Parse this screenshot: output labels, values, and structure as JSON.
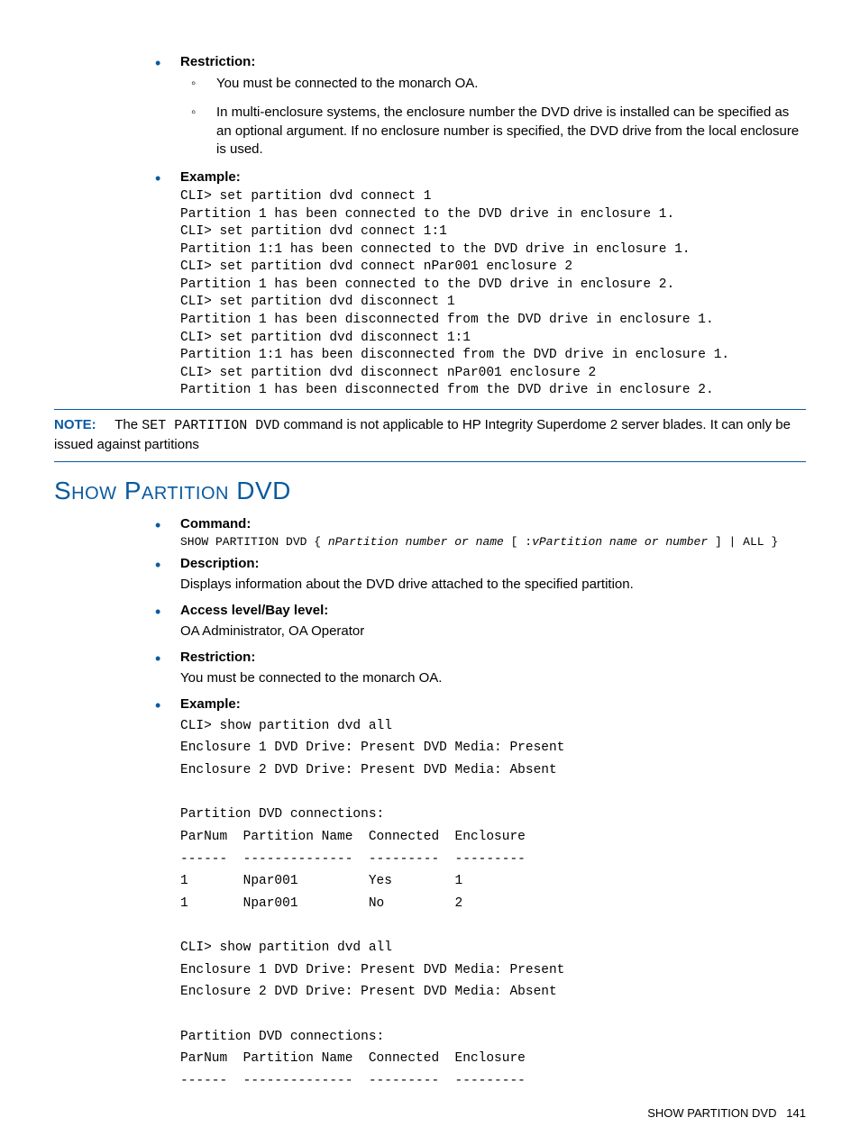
{
  "top": {
    "restriction_label": "Restriction:",
    "restriction_items": [
      "You must be connected to the monarch OA.",
      "In multi-enclosure systems, the enclosure number the DVD drive is installed can be specified as an optional argument. If no enclosure number is specified, the DVD drive from the local enclosure is used."
    ],
    "example_label": "Example:",
    "example_code": "CLI> set partition dvd connect 1\nPartition 1 has been connected to the DVD drive in enclosure 1.\nCLI> set partition dvd connect 1:1\nPartition 1:1 has been connected to the DVD drive in enclosure 1.\nCLI> set partition dvd connect nPar001 enclosure 2\nPartition 1 has been connected to the DVD drive in enclosure 2.\nCLI> set partition dvd disconnect 1\nPartition 1 has been disconnected from the DVD drive in enclosure 1.\nCLI> set partition dvd disconnect 1:1\nPartition 1:1 has been disconnected from the DVD drive in enclosure 1.\nCLI> set partition dvd disconnect nPar001 enclosure 2\nPartition 1 has been disconnected from the DVD drive in enclosure 2."
  },
  "note": {
    "label": "NOTE:",
    "pre": "The ",
    "code": "SET PARTITION DVD",
    "post": " command is not applicable to HP Integrity Superdome 2 server blades. It can only be issued against partitions"
  },
  "section": {
    "heading": "Show Partition DVD",
    "command_label": "Command:",
    "command_prefix": "SHOW PARTITION DVD { ",
    "command_it1": "nPartition number or name",
    "command_mid": " [ :",
    "command_it2": "vPartition name or number",
    "command_suffix": " ] | ALL }",
    "description_label": "Description:",
    "description_text": "Displays information about the DVD drive attached to the specified partition.",
    "access_label": "Access level/Bay level:",
    "access_text": "OA Administrator, OA Operator",
    "restriction_label": "Restriction:",
    "restriction_text": "You must be connected to the monarch OA.",
    "example_label": "Example:",
    "example_code": "CLI> show partition dvd all\nEnclosure 1 DVD Drive: Present DVD Media: Present\nEnclosure 2 DVD Drive: Present DVD Media: Absent\n\nPartition DVD connections:\nParNum  Partition Name  Connected  Enclosure\n------  --------------  ---------  ---------\n1       Npar001         Yes        1\n1       Npar001         No         2\n\nCLI> show partition dvd all\nEnclosure 1 DVD Drive: Present DVD Media: Present\nEnclosure 2 DVD Drive: Present DVD Media: Absent\n\nPartition DVD connections:\nParNum  Partition Name  Connected  Enclosure\n------  --------------  ---------  ---------"
  },
  "footer": {
    "title": "SHOW PARTITION DVD",
    "page": "141"
  }
}
